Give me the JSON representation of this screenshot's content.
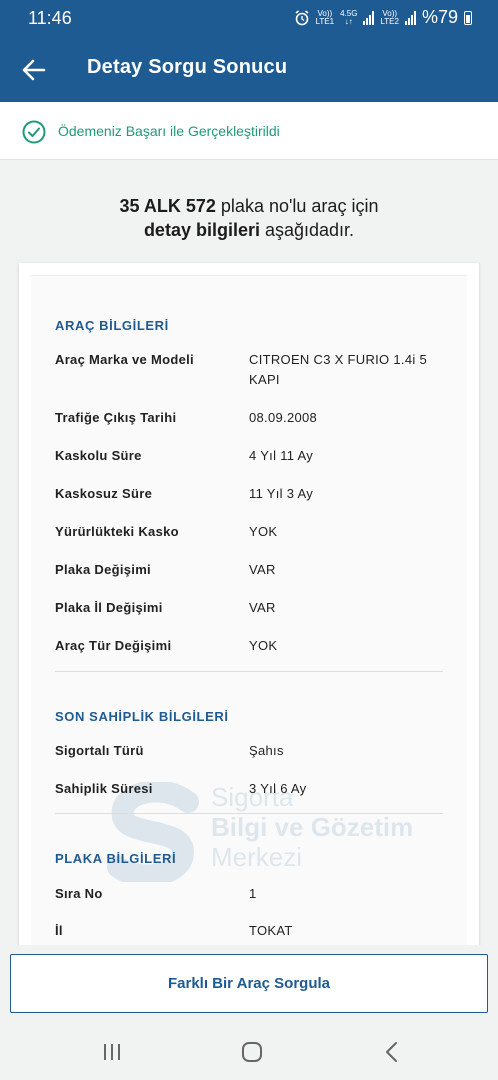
{
  "status_bar": {
    "time": "11:46",
    "net1_top": "Vo))",
    "net1_bottom": "LTE1",
    "net_type_top": "4.5G",
    "net_type_bottom": "↓↑",
    "net2_top": "Vo))",
    "net2_bottom": "LTE2",
    "battery": "%79",
    "icons": [
      "alarm-icon",
      "signal-icon",
      "battery-icon"
    ]
  },
  "app_bar": {
    "title": "Detay Sorgu Sonucu",
    "back_icon": "arrow-left-icon"
  },
  "banner": {
    "icon": "check-circle-icon",
    "text": "Ödemeniz Başarı ile Gerçekleştirildi"
  },
  "headline": {
    "plate": "35 ALK 572",
    "line1_rest": " plaka no'lu araç için",
    "line2_bold": "detay bilgileri",
    "line2_rest": " aşağıdadır."
  },
  "sections": {
    "vehicle": {
      "title": "ARAÇ BİLGİLERİ",
      "rows": [
        {
          "label": "Araç Marka ve Modeli",
          "value": "CITROEN C3 X FURIO 1.4i 5 KAPI"
        },
        {
          "label": "Trafiğe Çıkış Tarihi",
          "value": "08.09.2008"
        },
        {
          "label": "Kaskolu Süre",
          "value": "4 Yıl 11 Ay"
        },
        {
          "label": "Kaskosuz Süre",
          "value": "11 Yıl 3 Ay"
        },
        {
          "label": "Yürürlükteki Kasko",
          "value": "YOK"
        },
        {
          "label": "Plaka Değişimi",
          "value": "VAR"
        },
        {
          "label": "Plaka İl Değişimi",
          "value": "VAR"
        },
        {
          "label": "Araç Tür Değişimi",
          "value": "YOK"
        }
      ]
    },
    "ownership": {
      "title": "SON SAHİPLİK BİLGİLERİ",
      "rows": [
        {
          "label": "Sigortalı Türü",
          "value": "Şahıs"
        },
        {
          "label": "Sahiplik Süresi",
          "value": "3 Yıl 6 Ay"
        }
      ]
    },
    "plate": {
      "title": "PLAKA BİLGİLERİ",
      "rows": [
        {
          "label": "Sıra No",
          "value": "1"
        },
        {
          "label": "İl",
          "value": "TOKAT"
        }
      ]
    }
  },
  "watermark": {
    "line1": "Sigorta",
    "line2": "Bilgi ve Gözetim",
    "line3": "Merkezi"
  },
  "footer": {
    "button_label": "Farklı Bir Araç Sorgula"
  },
  "nav_bar": {
    "icons": [
      "recent-apps-icon",
      "home-icon",
      "back-icon"
    ]
  },
  "colors": {
    "primary": "#1f5b93",
    "success": "#1f9a7a",
    "background": "#f1f2f2"
  }
}
